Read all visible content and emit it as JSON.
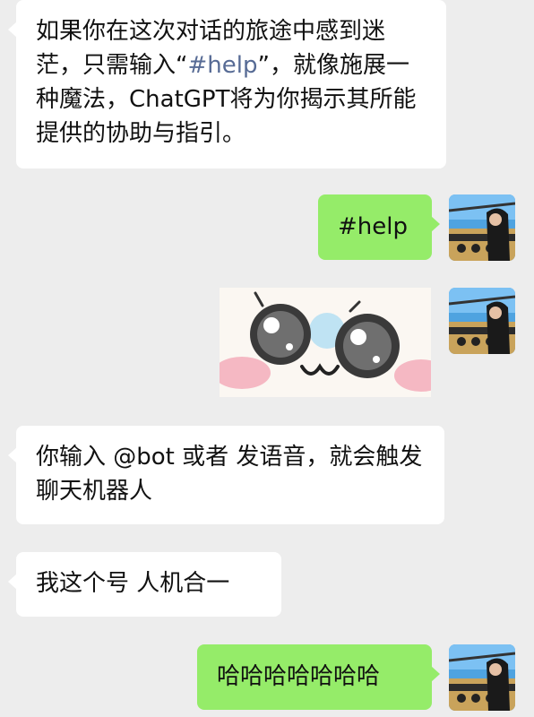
{
  "chat": {
    "messages": [
      {
        "side": "left",
        "text_before": "如果你在这次对话的旅途中感到迷茫，只需输入“",
        "highlight": "#help",
        "text_after": "”，就像施展一种魔法，ChatGPT将为你揭示其所能提供的协助与指引。"
      },
      {
        "side": "right",
        "text": "#help"
      },
      {
        "side": "right",
        "type": "sticker",
        "icon": "cute-cat-face-sticker"
      },
      {
        "side": "left",
        "text": "你输入 @bot 或者 发语音，就会触发聊天机器人"
      },
      {
        "side": "left",
        "text": "我这个号 人机合一"
      },
      {
        "side": "right",
        "text": "哈哈哈哈哈哈哈"
      }
    ]
  },
  "colors": {
    "background": "#ededed",
    "left_bubble": "#ffffff",
    "right_bubble": "#95ec69",
    "highlight_text": "#576b95"
  },
  "icons": {
    "avatar": "user-avatar-photo",
    "sticker": "cute-cat-face-sticker"
  }
}
